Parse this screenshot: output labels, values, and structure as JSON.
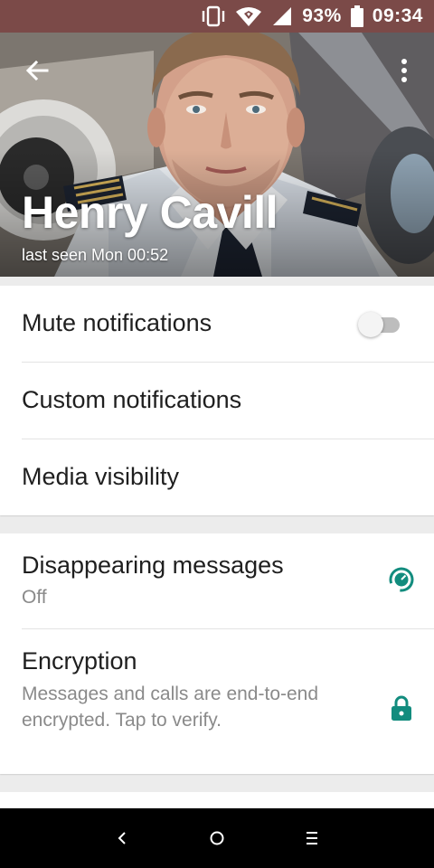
{
  "status_bar": {
    "battery": "93%",
    "time": "09:34",
    "icons": [
      "vibrate-icon",
      "wifi-icon",
      "signal-icon",
      "battery-icon"
    ]
  },
  "header": {
    "contact_name": "Henry Cavill",
    "last_seen": "last seen Mon 00:52",
    "icons": [
      "back-arrow-icon",
      "more-vert-icon"
    ]
  },
  "settings": {
    "mute_notifications": {
      "label": "Mute notifications",
      "enabled": false
    },
    "custom_notifications": {
      "label": "Custom notifications"
    },
    "media_visibility": {
      "label": "Media visibility"
    }
  },
  "privacy": {
    "disappearing_messages": {
      "label": "Disappearing messages",
      "value": "Off",
      "icon": "timer-icon"
    },
    "encryption": {
      "label": "Encryption",
      "description": "Messages and calls are end-to-end encrypted. Tap to verify.",
      "icon": "lock-icon"
    }
  },
  "nav_bar": {
    "icons": [
      "nav-back-icon",
      "nav-home-icon",
      "nav-recents-icon"
    ]
  },
  "colors": {
    "status_bar": "#7b4a48",
    "accent": "#128c7e",
    "text_primary": "#1f1f1f",
    "text_secondary": "#8a8a8a"
  }
}
